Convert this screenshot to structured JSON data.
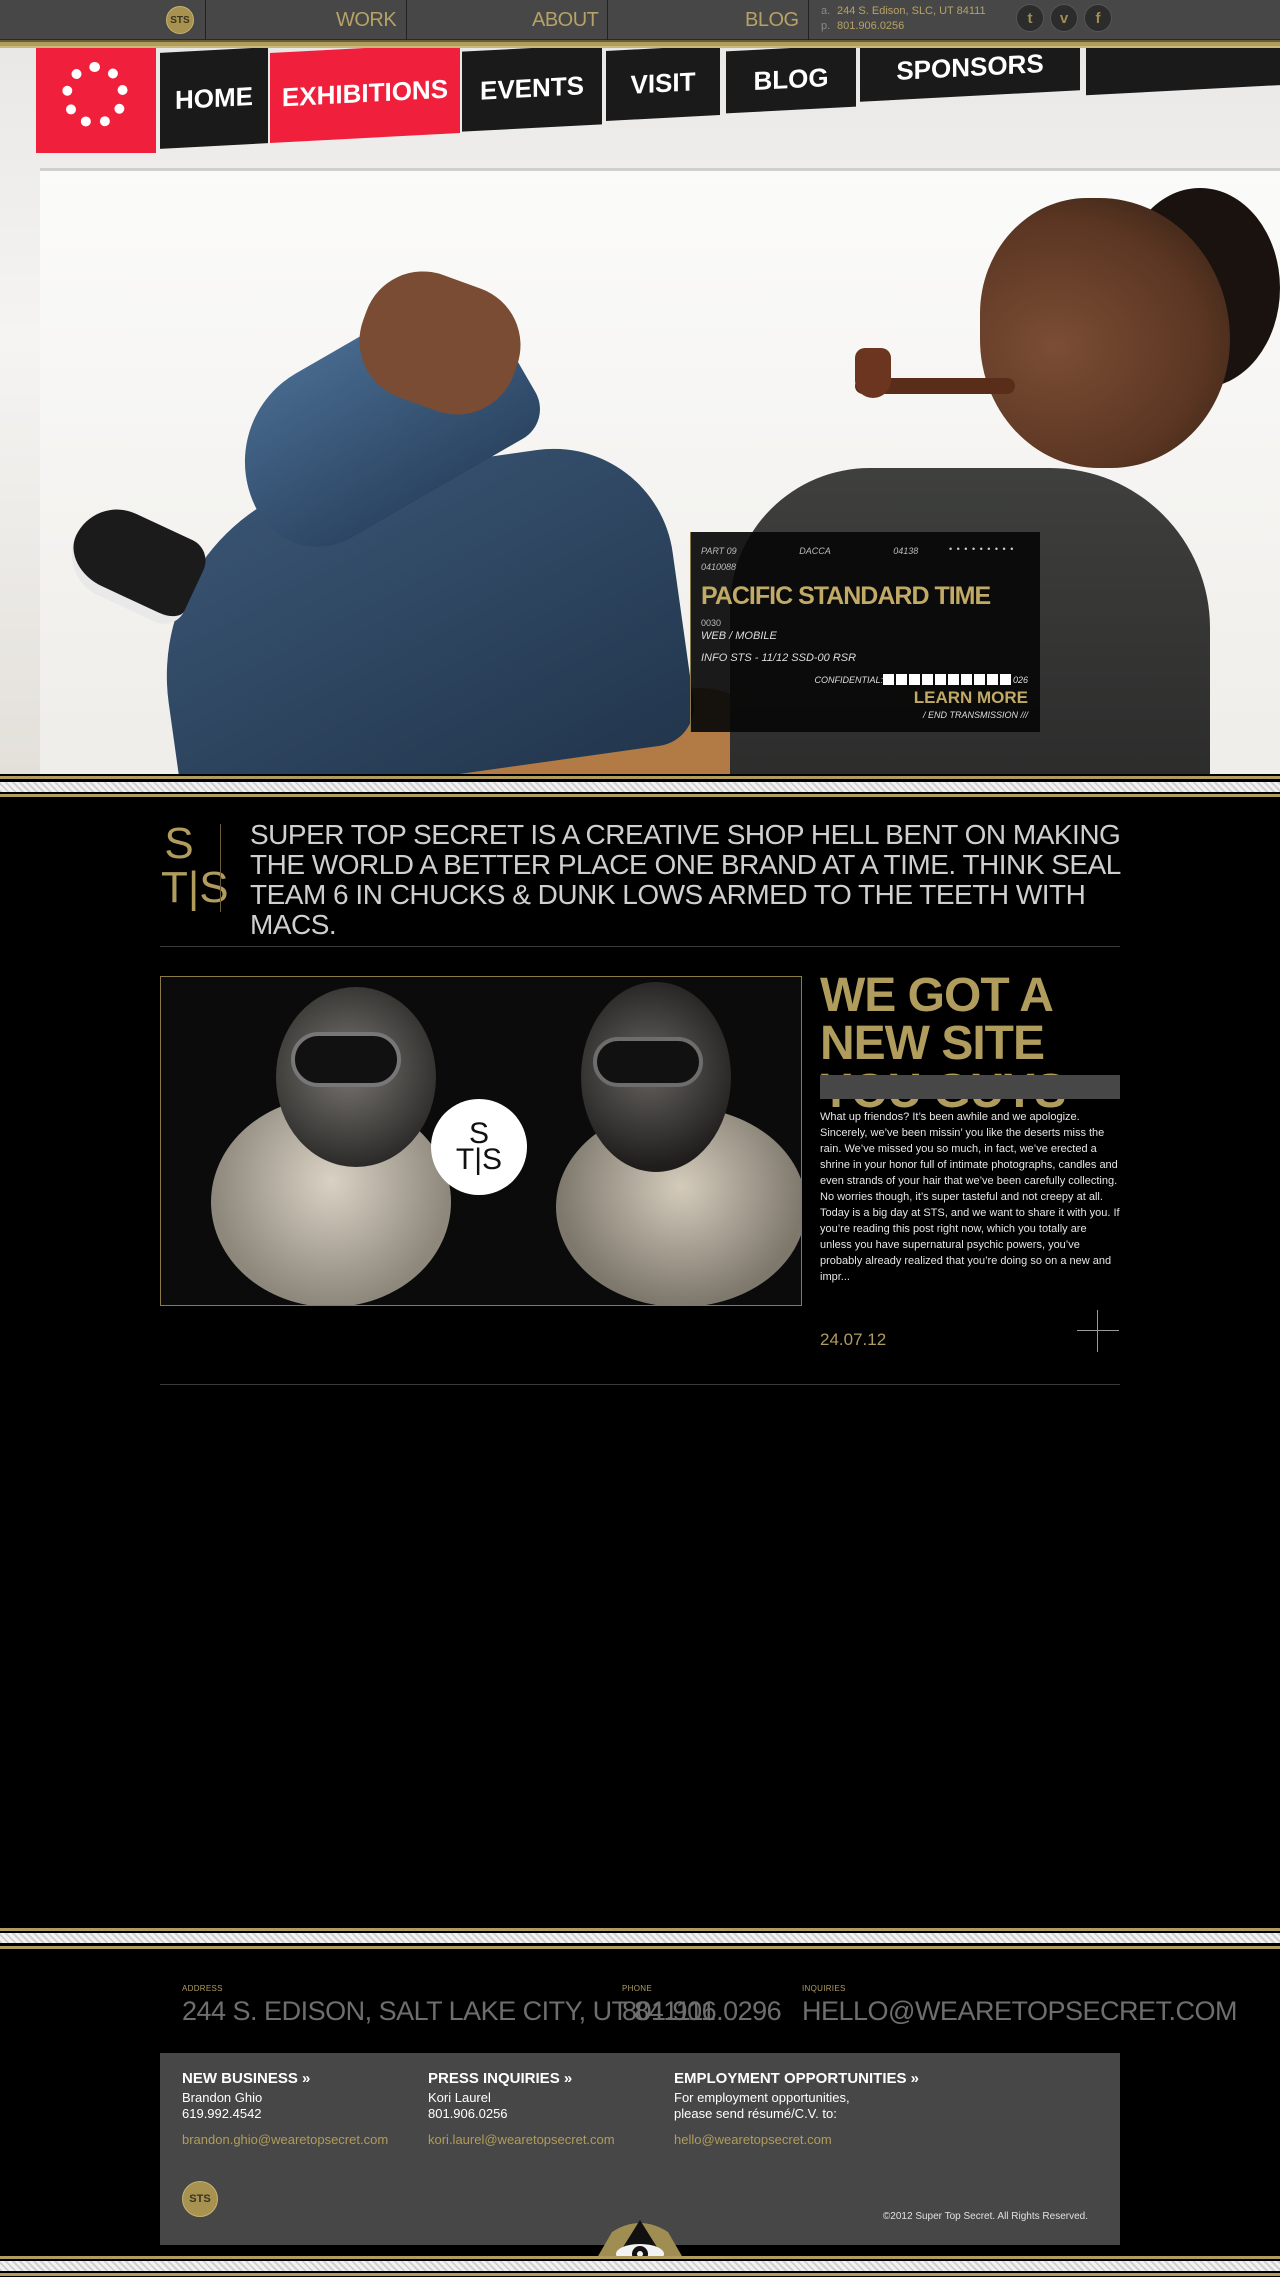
{
  "nav": {
    "logo_text": "STS",
    "items": [
      "WORK",
      "ABOUT",
      "BLOG"
    ],
    "address_key": "a.",
    "address": "244 S. Edison, SLC, UT 84111",
    "phone_key": "p.",
    "phone": "801.906.0256",
    "social": [
      {
        "name": "twitter-icon",
        "glyph": "t"
      },
      {
        "name": "vimeo-icon",
        "glyph": "v"
      },
      {
        "name": "facebook-icon",
        "glyph": "f"
      }
    ]
  },
  "hero": {
    "screen_tabs": [
      "HOME",
      "EXHIBITIONS",
      "EVENTS",
      "VISIT",
      "BLOG",
      "SPONSORS"
    ],
    "dossier": {
      "meta": [
        "PART 09",
        "DACCA",
        "04138"
      ],
      "dots": "• • • • • • • • •",
      "code": "0410088",
      "title": "PACIFIC STANDARD TIME",
      "number": "0030",
      "type": "WEB / MOBILE",
      "info": "INFO STS - 11/12 SSD-00 RSR",
      "confidential": "CONFIDENTIAL:",
      "conf_suffix": "026",
      "learn_more": "LEARN MORE",
      "end": "/ END TRANSMISSION ///"
    }
  },
  "intro": {
    "mark_top": "S",
    "mark_bottom": "T|S",
    "text": "SUPER TOP SECRET IS A CREATIVE SHOP HELL BENT ON MAKING THE WORLD A BETTER PLACE ONE BRAND AT A TIME. THINK SEAL TEAM 6 IN CHUCKS & DUNK LOWS ARMED TO THE TEETH WITH MACS."
  },
  "post": {
    "badge_top": "S",
    "badge_bottom": "T|S",
    "title": "WE GOT A NEW SITE YOU GUYS",
    "body": "What up friendos? It’s been awhile and we apologize. Sincerely, we’ve been missin’ you like the deserts miss the rain. We’ve missed you so much, in fact, we’ve erected a shrine in your honor full of intimate photographs, candles and even strands of your hair that we’ve been carefully collecting. No worries though, it’s super tasteful and not creepy at all. Today is a big day at STS, and we want to share it with you. If you’re reading this post right now, which you totally are unless you have supernatural psychic powers, you’ve probably already realized that you’re doing so on a new and impr...",
    "date": "24.07.12"
  },
  "footer": {
    "address_label": "ADDRESS",
    "address": "244 S. EDISON, SALT LAKE CITY, UT 841111",
    "phone_label": "PHONE",
    "phone": "801.906.0296",
    "inquiries_label": "INQUIRIES",
    "inquiries": "HELLO@WEARETOPSECRET.COM",
    "columns": [
      {
        "title": "NEW BUSINESS »",
        "line1": "Brandon Ghio",
        "line2": "619.992.4542",
        "email": "brandon.ghio@wearetopsecret.com"
      },
      {
        "title": "PRESS INQUIRIES »",
        "line1": "Kori Laurel",
        "line2": "801.906.0256",
        "email": "kori.laurel@wearetopsecret.com"
      },
      {
        "title": "EMPLOYMENT OPPORTUNITIES »",
        "line1": "For employment opportunities,",
        "line2": "please send résumé/C.V. to:",
        "email": "hello@wearetopsecret.com"
      }
    ],
    "badge": "STS",
    "copyright": "©2012 Super Top Secret. All Rights Reserved."
  },
  "colors": {
    "gold": "#b09c5c",
    "bar": "#474747",
    "accent_red": "#f0203c"
  }
}
